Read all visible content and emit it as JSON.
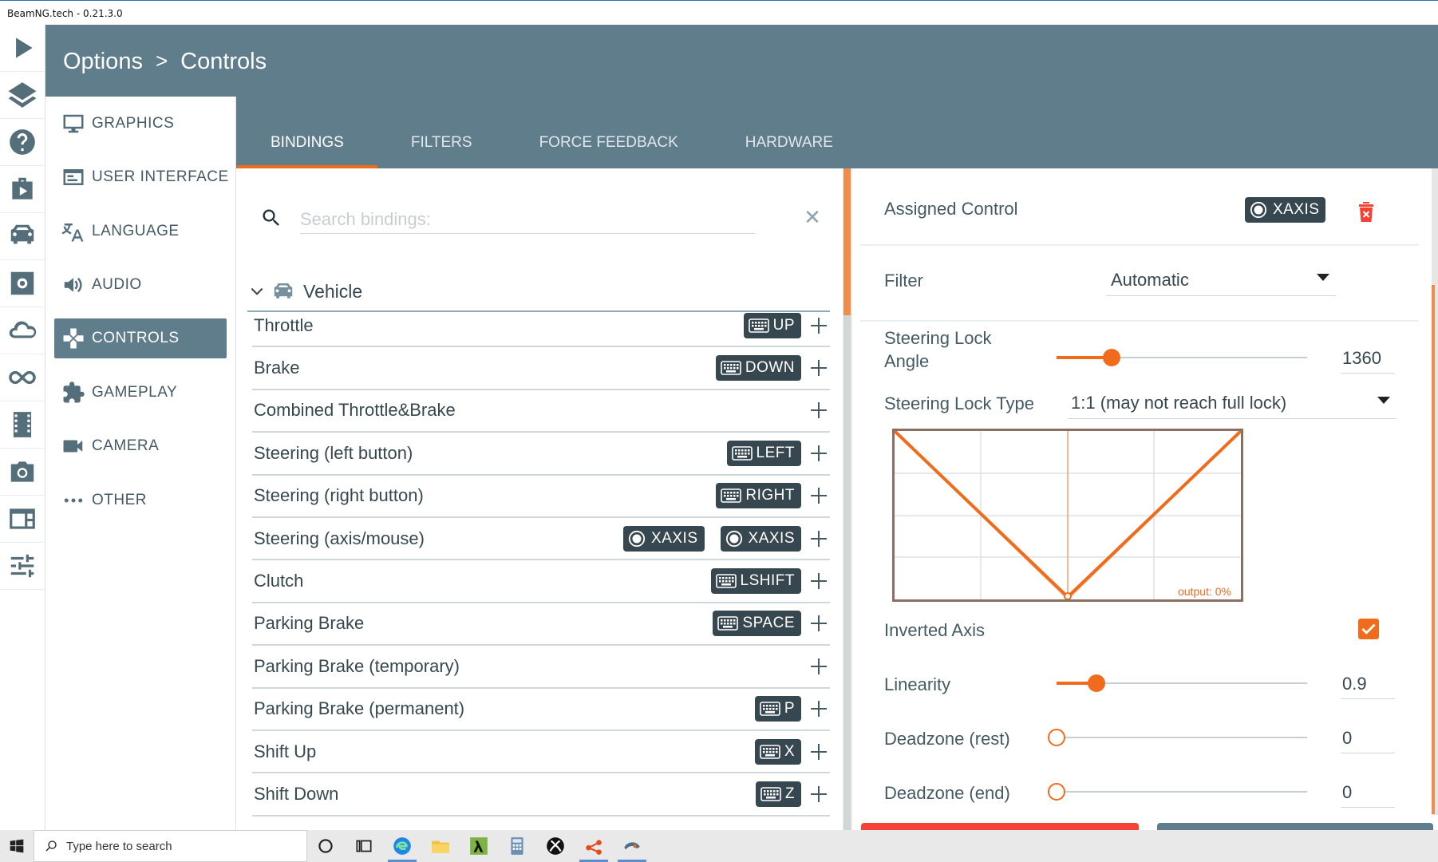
{
  "window": {
    "title": "BeamNG.tech - 0.21.3.0"
  },
  "rail": {
    "icons": [
      "play-icon",
      "layers-icon",
      "help-icon",
      "missions-icon",
      "vehicle-icon",
      "settings-icon",
      "cloud-icon",
      "loop-icon",
      "film-icon",
      "camera-icon",
      "dashboard-icon",
      "sliders-icon"
    ]
  },
  "header": {
    "breadcrumb_root": "Options",
    "breadcrumb_sep": ">",
    "breadcrumb_leaf": "Controls"
  },
  "tabs": [
    {
      "label": "BINDINGS",
      "active": true
    },
    {
      "label": "FILTERS"
    },
    {
      "label": "FORCE FEEDBACK"
    },
    {
      "label": "HARDWARE"
    }
  ],
  "menu": [
    {
      "label": "GRAPHICS",
      "icon": "monitor-icon"
    },
    {
      "label": "USER INTERFACE",
      "icon": "window-icon"
    },
    {
      "label": "LANGUAGE",
      "icon": "translate-icon"
    },
    {
      "label": "AUDIO",
      "icon": "speaker-icon"
    },
    {
      "label": "CONTROLS",
      "icon": "gamepad-icon",
      "active": true
    },
    {
      "label": "GAMEPLAY",
      "icon": "puzzle-icon"
    },
    {
      "label": "CAMERA",
      "icon": "videocam-icon"
    },
    {
      "label": "OTHER",
      "icon": "more-icon"
    }
  ],
  "search": {
    "placeholder": "Search bindings:",
    "value": ""
  },
  "group": {
    "label": "Vehicle"
  },
  "bindings": [
    {
      "label": "Throttle",
      "binds": [
        {
          "type": "keyboard",
          "key": "UP"
        }
      ]
    },
    {
      "label": "Brake",
      "binds": [
        {
          "type": "keyboard",
          "key": "DOWN"
        }
      ]
    },
    {
      "label": "Combined Throttle&Brake",
      "binds": []
    },
    {
      "label": "Steering (left button)",
      "binds": [
        {
          "type": "keyboard",
          "key": "LEFT"
        }
      ]
    },
    {
      "label": "Steering (right button)",
      "binds": [
        {
          "type": "keyboard",
          "key": "RIGHT"
        }
      ]
    },
    {
      "label": "Steering (axis/mouse)",
      "binds": [
        {
          "type": "axis",
          "key": "XAXIS"
        },
        {
          "type": "axis",
          "key": "XAXIS"
        }
      ]
    },
    {
      "label": "Clutch",
      "binds": [
        {
          "type": "keyboard",
          "key": "LSHIFT"
        }
      ]
    },
    {
      "label": "Parking Brake",
      "binds": [
        {
          "type": "keyboard",
          "key": "SPACE"
        }
      ]
    },
    {
      "label": "Parking Brake (temporary)",
      "binds": []
    },
    {
      "label": "Parking Brake (permanent)",
      "binds": [
        {
          "type": "keyboard",
          "key": "P"
        }
      ]
    },
    {
      "label": "Shift Up",
      "binds": [
        {
          "type": "keyboard",
          "key": "X"
        }
      ]
    },
    {
      "label": "Shift Down",
      "binds": [
        {
          "type": "keyboard",
          "key": "Z"
        }
      ]
    }
  ],
  "detail": {
    "assigned_label": "Assigned Control",
    "assigned_value": "XAXIS",
    "filter_label": "Filter",
    "filter_value": "Automatic",
    "lock_angle_label_1": "Steering Lock",
    "lock_angle_label_2": "Angle",
    "lock_angle_value": "1360",
    "lock_angle_fraction": 0.22,
    "lock_type_label": "Steering Lock Type",
    "lock_type_value": "1:1 (may not reach full lock)",
    "graph_output": "output: 0%",
    "inverted_label": "Inverted Axis",
    "inverted_checked": true,
    "linearity_label": "Linearity",
    "linearity_value": "0.9",
    "linearity_fraction": 0.16,
    "deadzone_rest_label": "Deadzone (rest)",
    "deadzone_rest_value": "0",
    "deadzone_rest_fraction": 0,
    "deadzone_end_label": "Deadzone (end)",
    "deadzone_end_value": "0",
    "deadzone_end_fraction": 0
  },
  "colors": {
    "accent": "#f06c1c",
    "header": "#607d8b",
    "chip": "#37474f"
  },
  "taskbar": {
    "search_placeholder": "Type here to search"
  }
}
